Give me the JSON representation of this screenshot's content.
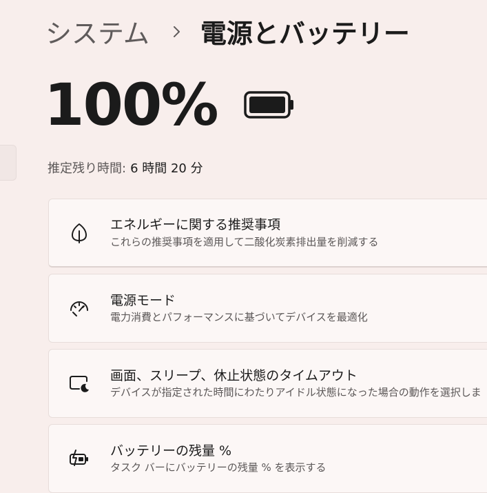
{
  "breadcrumb": {
    "parent": "システム",
    "separator": "›",
    "current": "電源とバッテリー"
  },
  "battery": {
    "percent_label": "100%",
    "charge_level": 1.0
  },
  "time_remaining": {
    "label": "推定残り時間:",
    "value": "6 時間 20 分"
  },
  "cards": [
    {
      "icon": "leaf-icon",
      "title": "エネルギーに関する推奨事項",
      "subtitle": "これらの推奨事項を適用して二酸化炭素排出量を削減する"
    },
    {
      "icon": "gauge-icon",
      "title": "電源モード",
      "subtitle": "電力消費とパフォーマンスに基づいてデバイスを最適化"
    },
    {
      "icon": "screen-sleep-icon",
      "title": "画面、スリープ、休止状態のタイムアウト",
      "subtitle": "デバイスが指定された時間にわたりアイドル状態になった場合の動作を選択しま"
    },
    {
      "icon": "battery-saver-icon",
      "title": "バッテリーの残量 %",
      "subtitle": "タスク バーにバッテリーの残量 % を表示する"
    }
  ],
  "colors": {
    "background": "#f8eeec",
    "card_background": "#fcf7f6",
    "text_primary": "#1b1b1b",
    "text_secondary": "#5b5757"
  }
}
